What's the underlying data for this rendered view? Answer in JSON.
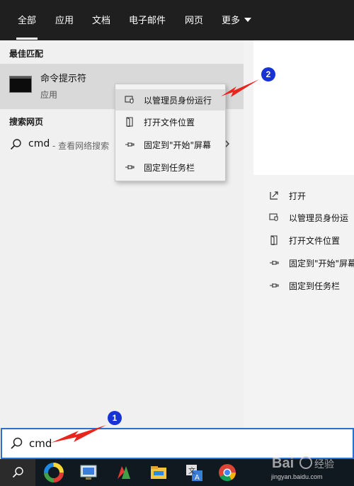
{
  "tabs": [
    {
      "label": "全部",
      "active": true
    },
    {
      "label": "应用"
    },
    {
      "label": "文档"
    },
    {
      "label": "电子邮件"
    },
    {
      "label": "网页"
    },
    {
      "label": "更多"
    }
  ],
  "best_match": {
    "heading": "最佳匹配",
    "title": "命令提示符",
    "subtitle": "应用"
  },
  "web": {
    "heading": "搜索网页",
    "query": "cmd",
    "desc": "- 查看网络搜索"
  },
  "context_menu": {
    "items": [
      {
        "label": "以管理员身份运行",
        "icon": "shield-run-icon",
        "highlighted": true
      },
      {
        "label": "打开文件位置",
        "icon": "file-location-icon"
      },
      {
        "label": "固定到\"开始\"屏幕",
        "icon": "pin-icon"
      },
      {
        "label": "固定到任务栏",
        "icon": "pin-icon"
      }
    ]
  },
  "preview_actions": [
    {
      "label": "打开",
      "icon": "open-icon"
    },
    {
      "label": "以管理员身份运",
      "icon": "shield-run-icon"
    },
    {
      "label": "打开文件位置",
      "icon": "file-location-icon"
    },
    {
      "label": "固定到\"开始\"屏幕",
      "icon": "pin-icon"
    },
    {
      "label": "固定到任务栏",
      "icon": "pin-icon"
    }
  ],
  "search": {
    "value": "cmd"
  },
  "taskbar": {
    "apps": [
      {
        "name": "colorful-circle-app-icon"
      },
      {
        "name": "remote-desktop-app-icon"
      },
      {
        "name": "wps-app-icon"
      },
      {
        "name": "file-explorer-icon"
      },
      {
        "name": "translate-app-icon"
      },
      {
        "name": "chrome-icon"
      }
    ]
  },
  "annotations": {
    "step1": "1",
    "step2": "2"
  },
  "watermark": {
    "text": "jingyan.baidu.com"
  },
  "colors": {
    "accent": "#2b6fd1",
    "annotation_blue": "#1733d6",
    "arrow_red": "#e8251c",
    "taskbar": "#101820"
  }
}
